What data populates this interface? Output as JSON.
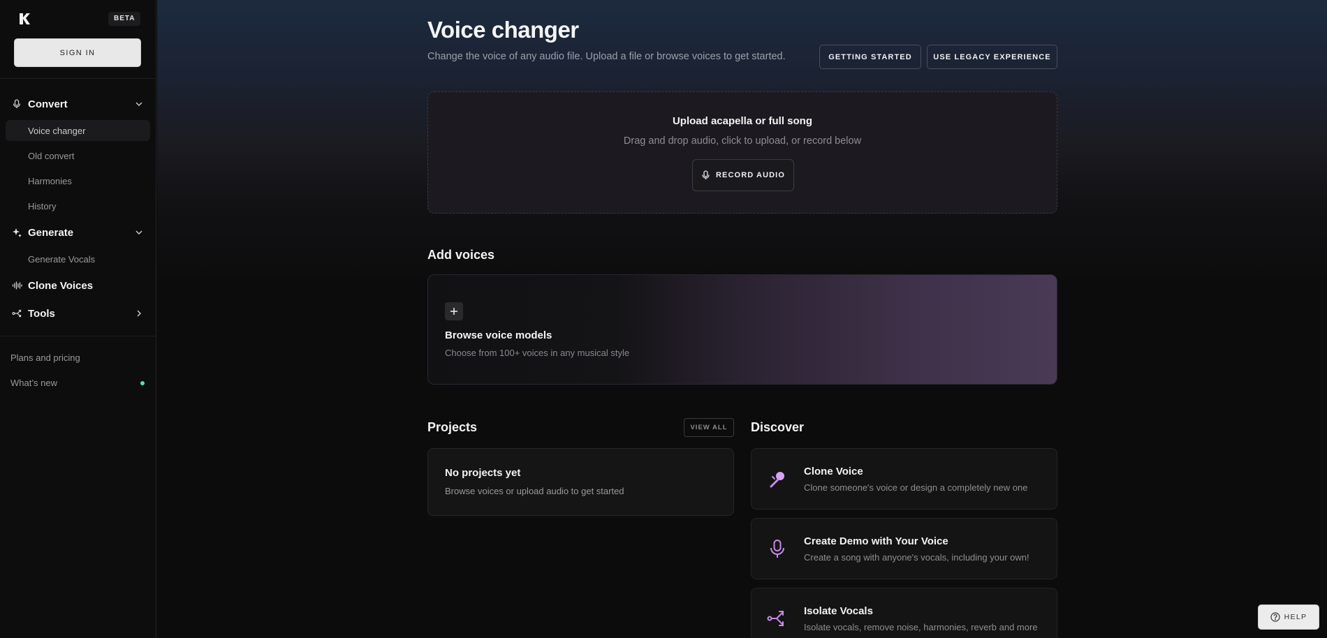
{
  "sidebar": {
    "beta_label": "BETA",
    "sign_in_label": "SIGN IN",
    "convert": {
      "label": "Convert",
      "items": [
        "Voice changer",
        "Old convert",
        "Harmonies",
        "History"
      ]
    },
    "generate": {
      "label": "Generate",
      "items": [
        "Generate Vocals"
      ]
    },
    "clone_voices_label": "Clone Voices",
    "tools_label": "Tools",
    "plans_label": "Plans and pricing",
    "whats_new_label": "What’s new"
  },
  "header": {
    "title": "Voice changer",
    "subtitle": "Change the voice of any audio file. Upload a file or browse voices to get started.",
    "getting_started_label": "GETTING STARTED",
    "legacy_label": "USE LEGACY EXPERIENCE"
  },
  "upload": {
    "title": "Upload acapella or full song",
    "subtitle": "Drag and drop audio, click to upload, or record below",
    "record_label": "RECORD AUDIO"
  },
  "add_voices": {
    "title": "Add voices",
    "card_title": "Browse voice models",
    "card_subtitle": "Choose from 100+ voices in any musical style"
  },
  "projects": {
    "title": "Projects",
    "view_all_label": "VIEW ALL",
    "empty_title": "No projects yet",
    "empty_subtitle": "Browse voices or upload audio to get started"
  },
  "discover": {
    "title": "Discover",
    "items": [
      {
        "title": "Clone Voice",
        "subtitle": "Clone someone's voice or design a completely new one"
      },
      {
        "title": "Create Demo with Your Voice",
        "subtitle": "Create a song with anyone's vocals, including your own!"
      },
      {
        "title": "Isolate Vocals",
        "subtitle": "Isolate vocals, remove noise, harmonies, reverb and more"
      }
    ]
  },
  "help_label": "HELP",
  "colors": {
    "accent_purple": "#c98bea",
    "status_green": "#58e0b0"
  }
}
